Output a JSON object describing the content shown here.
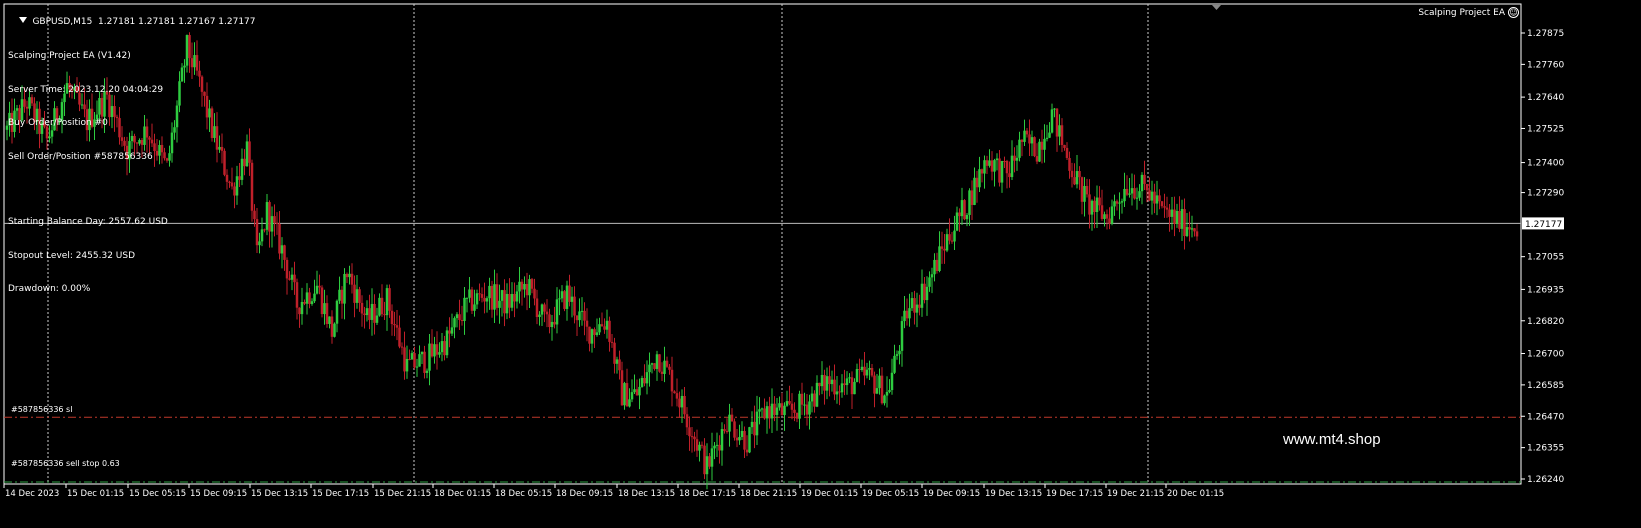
{
  "header": {
    "symbol_line": "GBPUSD,M15  1.27181 1.27181 1.27167 1.27177",
    "ea_name": "Scalping Project EA"
  },
  "ea_panel": {
    "title": "Scalping Project EA (V1.42)",
    "server_time": "Server Time: 2023.12.20 04:04:29",
    "buy_orders": "Buy Order/Position #0",
    "sell_orders": "Sell Order/Position #587856336",
    "starting_balance": "Starting Balance Day: 2557.62 USD",
    "stopout_level": "Stopout Level: 2455.32 USD",
    "drawdown": "Drawdown: 0.00%"
  },
  "watermark": "www.mt4.shop",
  "order_lines": {
    "sl_label": "#587856336 sl",
    "sl_price": 1.2647,
    "sl_color": "#c0392b",
    "pending_label": "#587856336 sell stop 0.63",
    "pending_price": 1.2624,
    "pending_color": "#2ea043"
  },
  "current_price": {
    "label": "1.27177",
    "value": 1.27177
  },
  "colors": {
    "background": "#000000",
    "bull": "#2ecc40",
    "bear": "#c0202a",
    "grid": "#cccccc",
    "axis_text": "#ffffff"
  },
  "chart_data": {
    "type": "candlestick",
    "symbol": "GBPUSD",
    "timeframe": "M15",
    "price_ticks": [
      "1.27875",
      "1.27760",
      "1.27640",
      "1.27525",
      "1.27400",
      "1.27290",
      "1.27177",
      "1.27055",
      "1.26935",
      "1.26820",
      "1.26700",
      "1.26585",
      "1.26470",
      "1.26355",
      "1.26240"
    ],
    "ylim": [
      1.2621,
      1.2791
    ],
    "time_labels": [
      "14 Dec 2023",
      "15 Dec 01:15",
      "15 Dec 05:15",
      "15 Dec 09:15",
      "15 Dec 13:15",
      "15 Dec 17:15",
      "15 Dec 21:15",
      "18 Dec 01:15",
      "18 Dec 05:15",
      "18 Dec 09:15",
      "18 Dec 13:15",
      "18 Dec 17:15",
      "18 Dec 21:15",
      "19 Dec 01:15",
      "19 Dec 05:15",
      "19 Dec 09:15",
      "19 Dec 13:15",
      "19 Dec 17:15",
      "19 Dec 21:15",
      "20 Dec 01:15"
    ],
    "day_separators": [
      "15 Dec",
      "18 Dec",
      "19 Dec",
      "20 Dec"
    ],
    "close_path": [
      [
        0,
        1.2752
      ],
      [
        8,
        1.2762
      ],
      [
        16,
        1.2748
      ],
      [
        24,
        1.2768
      ],
      [
        32,
        1.2755
      ],
      [
        40,
        1.2764
      ],
      [
        48,
        1.2745
      ],
      [
        56,
        1.2752
      ],
      [
        64,
        1.2738
      ],
      [
        72,
        1.2782
      ],
      [
        76,
        1.2772
      ],
      [
        82,
        1.2752
      ],
      [
        90,
        1.273
      ],
      [
        96,
        1.2745
      ],
      [
        100,
        1.2705
      ],
      [
        104,
        1.2722
      ],
      [
        110,
        1.2708
      ],
      [
        116,
        1.2688
      ],
      [
        124,
        1.2695
      ],
      [
        130,
        1.2678
      ],
      [
        136,
        1.27
      ],
      [
        144,
        1.2682
      ],
      [
        152,
        1.269
      ],
      [
        160,
        1.2665
      ],
      [
        168,
        1.2668
      ],
      [
        176,
        1.2675
      ],
      [
        184,
        1.2688
      ],
      [
        192,
        1.2692
      ],
      [
        200,
        1.2688
      ],
      [
        208,
        1.2695
      ],
      [
        216,
        1.268
      ],
      [
        224,
        1.2692
      ],
      [
        232,
        1.2678
      ],
      [
        240,
        1.2682
      ],
      [
        246,
        1.2655
      ],
      [
        252,
        1.2655
      ],
      [
        260,
        1.267
      ],
      [
        266,
        1.266
      ],
      [
        274,
        1.2642
      ],
      [
        280,
        1.2628
      ],
      [
        288,
        1.2646
      ],
      [
        296,
        1.2638
      ],
      [
        304,
        1.265
      ],
      [
        312,
        1.2648
      ],
      [
        320,
        1.2652
      ],
      [
        328,
        1.266
      ],
      [
        336,
        1.2658
      ],
      [
        344,
        1.2662
      ],
      [
        352,
        1.2655
      ],
      [
        360,
        1.2685
      ],
      [
        368,
        1.2695
      ],
      [
        376,
        1.2712
      ],
      [
        384,
        1.2725
      ],
      [
        392,
        1.2742
      ],
      [
        400,
        1.2735
      ],
      [
        406,
        1.2748
      ],
      [
        412,
        1.2745
      ],
      [
        418,
        1.2758
      ],
      [
        424,
        1.2742
      ],
      [
        432,
        1.2725
      ],
      [
        440,
        1.272
      ],
      [
        448,
        1.2732
      ],
      [
        456,
        1.273
      ],
      [
        462,
        1.2722
      ],
      [
        470,
        1.2718
      ],
      [
        476,
        1.2717
      ]
    ]
  }
}
